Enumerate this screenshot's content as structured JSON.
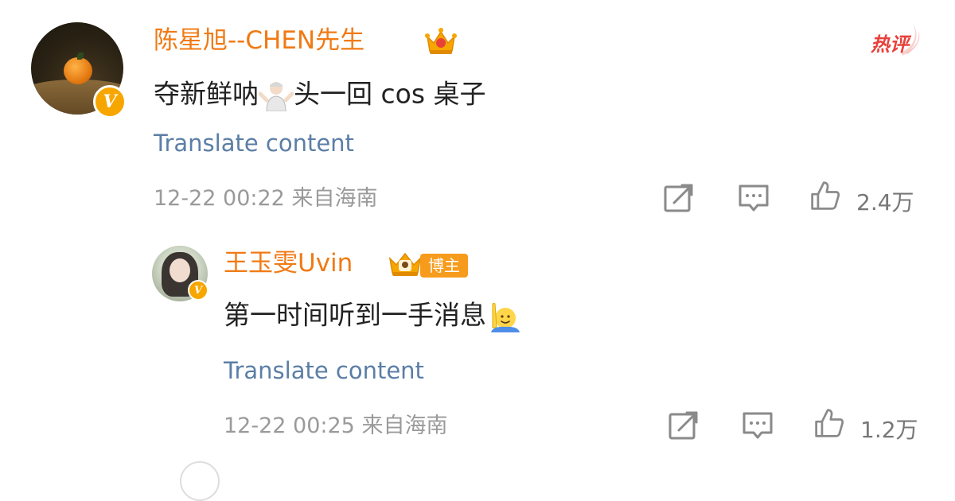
{
  "comment": {
    "username": "陈星旭--CHEN先生",
    "text_before_emoji": "夺新鲜呐",
    "emoji_name": "man-shrugging-emoji",
    "text_after_emoji": "头一回 cos 桌子",
    "hot_label": "热评",
    "translate_label": "Translate content",
    "timestamp": "12-22 00:22",
    "location": "来自海南",
    "like_count": "2.4万",
    "icons": {
      "share": "share-icon",
      "comment": "comment-icon",
      "like": "thumbs-up-icon",
      "badge": "crown-vip-icon",
      "verified": "verified-v-icon"
    }
  },
  "reply": {
    "username": "王玉雯Uvin",
    "author_tag": "博主",
    "text": "第一时间听到一手消息",
    "emoji_name": "person-raising-hand-emoji",
    "translate_label": "Translate content",
    "timestamp": "12-22 00:25",
    "location": "来自海南",
    "like_count": "1.2万",
    "icons": {
      "share": "share-icon",
      "comment": "comment-icon",
      "like": "thumbs-up-icon",
      "badge": "crown-vip-icon",
      "verified": "verified-v-icon"
    }
  },
  "colors": {
    "username": "#f07a14",
    "translate_link": "#5b7ea6",
    "meta_text": "#9a9a9a",
    "hot_tag": "#e8413a",
    "blogger_tag_bg": "#f79b1c",
    "verified_badge": "#f7a600"
  }
}
